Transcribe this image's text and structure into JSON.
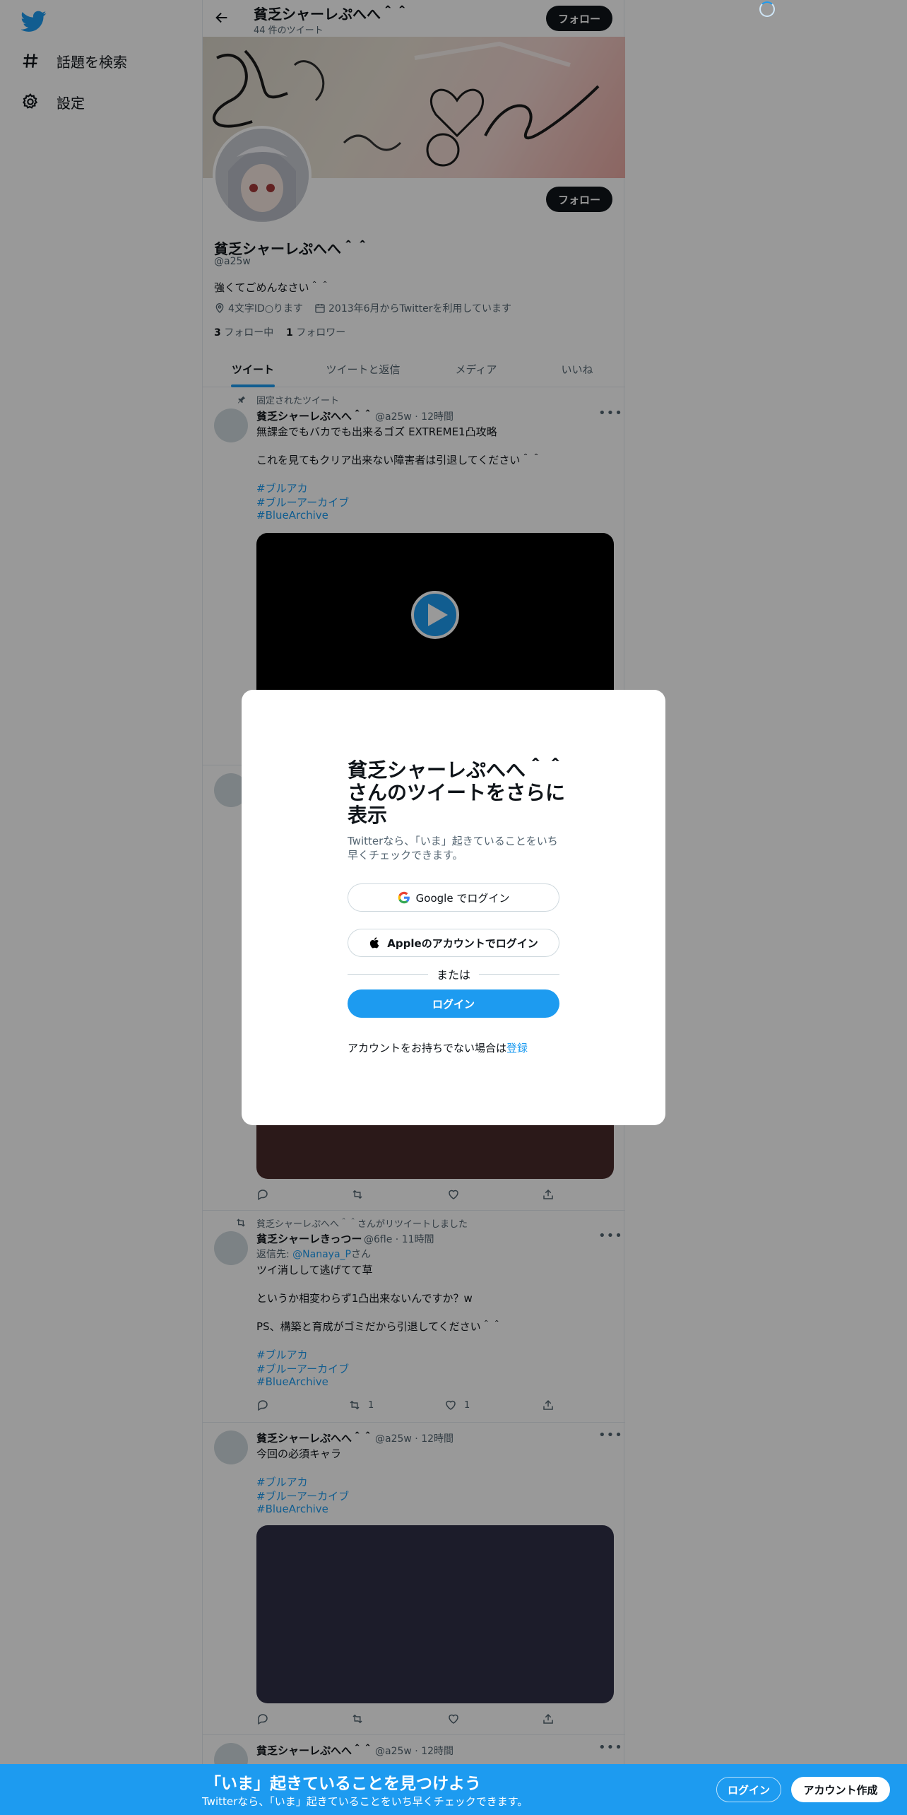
{
  "nav": {
    "logo_icon": "twitter-bird-icon",
    "explore_label": "話題を検索",
    "settings_label": "設定"
  },
  "header": {
    "title": "貧乏シャーレぷへへ＾＾",
    "tweet_count": "44 件のツイート",
    "follow_label": "フォロー"
  },
  "profile": {
    "name": "貧乏シャーレぷへへ＾＾",
    "handle": "@a25w",
    "bio": "強くてごめんなさい＾＾",
    "location": "4文字ID○ります",
    "joined": "2013年6月からTwitterを利用しています",
    "following_count": "3",
    "following_label": "フォロー中",
    "followers_count": "1",
    "followers_label": "フォロワー",
    "follow_label": "フォロー"
  },
  "tabs": [
    "ツイート",
    "ツイートと返信",
    "メディア",
    "いいね"
  ],
  "tweets": [
    {
      "social": "固定されたツイート",
      "name": "貧乏シャーレぷへへ＾＾",
      "meta": "@a25w · 12時間",
      "lines": [
        "無課金でもバカでも出来るゴズ EXTREME1凸攻略",
        "これを見てもクリア出来ない障害者は引退してください＾＾"
      ],
      "tags": [
        "#ブルアカ",
        "#ブルーアーカイブ",
        "#BlueArchive"
      ]
    },
    {
      "social": "貧乏シャーレぷへへ＾＾さんがリツイートしました",
      "name": "貧乏シャーレきっつー",
      "meta": "@6fle · 11時間",
      "reply_prefix": "返信先:",
      "reply_user": "@Nanaya_P",
      "reply_suffix": "さん",
      "lines": [
        "ツイ消しして逃げてて草",
        "というか相変わらず1凸出来ないんですか？w",
        "PS、構築と育成がゴミだから引退してください＾＾"
      ],
      "tags": [
        "#ブルアカ",
        "#ブルーアーカイブ",
        "#BlueArchive"
      ],
      "retweets": "1",
      "likes": "1"
    },
    {
      "name": "貧乏シャーレぷへへ＾＾",
      "meta": "@a25w · 12時間",
      "lines": [
        "今回の必須キャラ"
      ],
      "tags": [
        "#ブルアカ",
        "#ブルーアーカイブ",
        "#BlueArchive"
      ]
    },
    {
      "name": "貧乏シャーレぷへへ＾＾",
      "meta": "@a25w · 12時間"
    }
  ],
  "modal": {
    "title": "貧乏シャーレぷへへ＾＾さんのツイートをさらに表示",
    "subtitle": "Twitterなら、「いま」起きていることをいち早くチェックできます。",
    "google_label": "Google でログイン",
    "apple_label": "Appleのアカウントでログイン",
    "or_label": "または",
    "login_label": "ログイン",
    "signup_prefix": "アカウントをお持ちでない場合は",
    "signup_link": "登録"
  },
  "bottom_bar": {
    "title": "「いま」起きていることを見つけよう",
    "subtitle": "Twitterなら、「いま」起きていることをいち早くチェックできます。",
    "login_label": "ログイン",
    "signup_label": "アカウント作成"
  },
  "colors": {
    "accent": "#1d9bf0",
    "text": "#0f1419",
    "muted": "#536471",
    "media_dark": "#000000",
    "media_brown": "#482a2a",
    "media_navy": "#2f3046"
  }
}
